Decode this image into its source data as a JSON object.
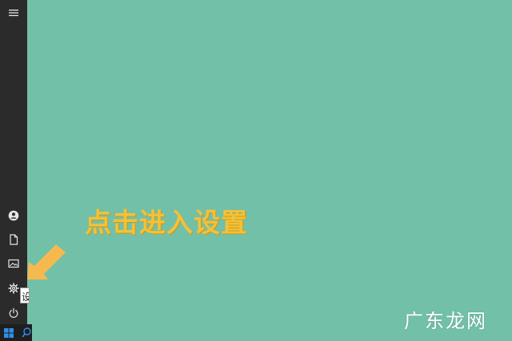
{
  "annotation": {
    "text": "点击进入设置",
    "color": "#f3c13a"
  },
  "watermark": {
    "text": "广东龙网"
  },
  "tooltip": {
    "text": "设"
  },
  "colors": {
    "desktop": "#72c0a8",
    "rail": "#2b2b2b",
    "taskbar": "#1f1f1f",
    "arrow": "#f5b94f",
    "windows_logo": "#2f8fe8"
  },
  "rail": {
    "icons": [
      "hamburger-menu-icon",
      "user-account-icon",
      "documents-icon",
      "pictures-icon",
      "settings-gear-icon",
      "power-icon"
    ]
  },
  "taskbar": {
    "icons": [
      "windows-logo-icon",
      "search-icon"
    ]
  }
}
